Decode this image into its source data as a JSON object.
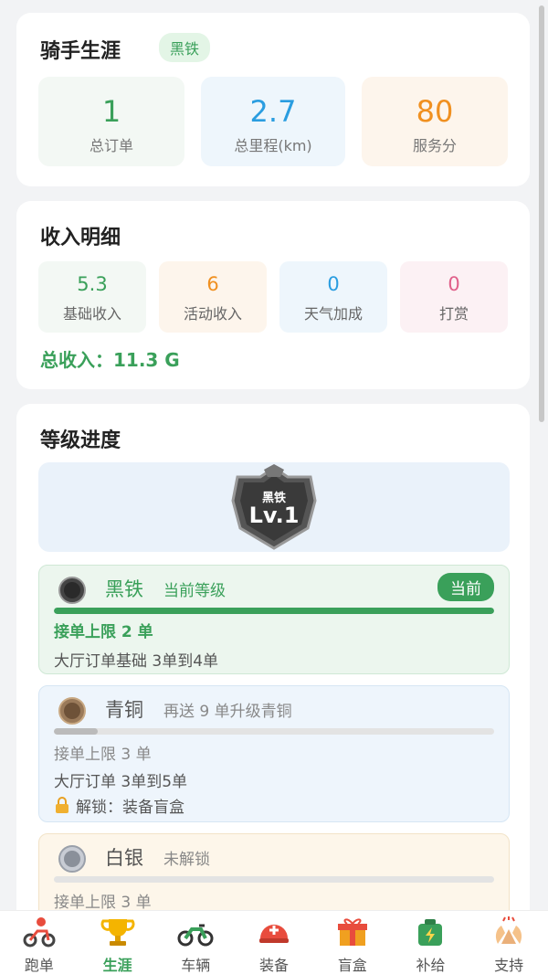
{
  "career": {
    "title": "骑手生涯",
    "tier_badge": "黑铁",
    "stats": [
      {
        "value": "1",
        "label": "总订单",
        "color": "#3aa05a"
      },
      {
        "value": "2.7",
        "label": "总里程(km)",
        "color": "#2a9de0"
      },
      {
        "value": "80",
        "label": "服务分",
        "color": "#f09020"
      }
    ]
  },
  "income": {
    "title": "收入明细",
    "items": [
      {
        "value": "5.3",
        "label": "基础收入",
        "color": "#3aa05a"
      },
      {
        "value": "6",
        "label": "活动收入",
        "color": "#f09020"
      },
      {
        "value": "0",
        "label": "天气加成",
        "color": "#2a9de0"
      },
      {
        "value": "0",
        "label": "打赏",
        "color": "#e0608a"
      }
    ],
    "total": "总收入：11.3 G"
  },
  "level": {
    "title": "等级进度",
    "emblem_tier": "黑铁",
    "emblem_level": "Lv.1",
    "levels": [
      {
        "name": "黑铁",
        "sub": "当前等级",
        "badge": "当前",
        "progress": 1.0,
        "line1": "接单上限 2 单",
        "line2": "大厅订单基础 3单到4单"
      },
      {
        "name": "青铜",
        "sub": "再送 9 单升级青铜",
        "progress": 0.1,
        "line1": "接单上限 3 单",
        "line2": "大厅订单 3单到5单",
        "unlock": "解锁：装备盲盒"
      },
      {
        "name": "白银",
        "sub": "未解锁",
        "progress": 0.0,
        "line1": "接单上限 3 单"
      }
    ]
  },
  "tabbar": {
    "items": [
      {
        "label": "跑单",
        "icon": "bike-rider-icon"
      },
      {
        "label": "生涯",
        "icon": "trophy-icon",
        "active": true
      },
      {
        "label": "车辆",
        "icon": "motorcycle-icon"
      },
      {
        "label": "装备",
        "icon": "helmet-icon"
      },
      {
        "label": "盲盒",
        "icon": "gift-box-icon"
      },
      {
        "label": "补给",
        "icon": "battery-supply-icon"
      },
      {
        "label": "支持",
        "icon": "clapping-hands-icon"
      }
    ]
  }
}
